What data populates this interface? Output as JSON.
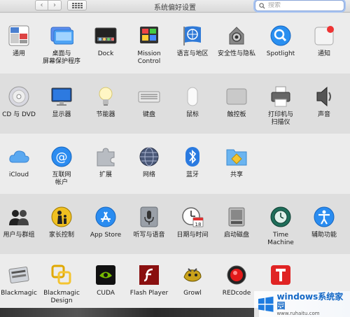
{
  "window": {
    "title": "系统偏好设置"
  },
  "toolbar": {
    "back_label": "‹",
    "forward_label": "›"
  },
  "search": {
    "placeholder": "搜索"
  },
  "rows": [
    {
      "items": [
        {
          "label": "通用",
          "icon": "general-icon"
        },
        {
          "label": "桌面与\n屏幕保护程序",
          "icon": "desktop-icon"
        },
        {
          "label": "Dock",
          "icon": "dock-icon"
        },
        {
          "label": "Mission\nControl",
          "icon": "mission-control-icon"
        },
        {
          "label": "语言与地区",
          "icon": "language-region-icon"
        },
        {
          "label": "安全性与隐私",
          "icon": "security-privacy-icon"
        },
        {
          "label": "Spotlight",
          "icon": "spotlight-icon"
        },
        {
          "label": "通知",
          "icon": "notifications-icon"
        }
      ]
    },
    {
      "items": [
        {
          "label": "CD 与 DVD",
          "icon": "cd-dvd-icon"
        },
        {
          "label": "显示器",
          "icon": "displays-icon"
        },
        {
          "label": "节能器",
          "icon": "energy-saver-icon"
        },
        {
          "label": "键盘",
          "icon": "keyboard-icon"
        },
        {
          "label": "鼠标",
          "icon": "mouse-icon"
        },
        {
          "label": "触控板",
          "icon": "trackpad-icon"
        },
        {
          "label": "打印机与\n扫描仪",
          "icon": "printer-icon"
        },
        {
          "label": "声音",
          "icon": "sound-icon"
        }
      ]
    },
    {
      "items": [
        {
          "label": "iCloud",
          "icon": "icloud-icon"
        },
        {
          "label": "互联网\n帐户",
          "icon": "internet-accounts-icon"
        },
        {
          "label": "扩展",
          "icon": "extensions-icon"
        },
        {
          "label": "网络",
          "icon": "network-icon"
        },
        {
          "label": "蓝牙",
          "icon": "bluetooth-icon"
        },
        {
          "label": "共享",
          "icon": "sharing-icon"
        }
      ]
    },
    {
      "items": [
        {
          "label": "用户与群组",
          "icon": "users-groups-icon"
        },
        {
          "label": "家长控制",
          "icon": "parental-controls-icon"
        },
        {
          "label": "App Store",
          "icon": "app-store-icon"
        },
        {
          "label": "听写与语音",
          "icon": "dictation-speech-icon"
        },
        {
          "label": "日期与时间",
          "icon": "date-time-icon"
        },
        {
          "label": "启动磁盘",
          "icon": "startup-disk-icon"
        },
        {
          "label": "Time Machine",
          "icon": "time-machine-icon"
        },
        {
          "label": "辅助功能",
          "icon": "accessibility-icon"
        }
      ]
    },
    {
      "items": [
        {
          "label": "Blackmagic",
          "icon": "blackmagic-icon"
        },
        {
          "label": "Blackmagic\nDesign",
          "icon": "blackmagic-design-icon"
        },
        {
          "label": "CUDA",
          "icon": "cuda-icon"
        },
        {
          "label": "Flash Player",
          "icon": "flash-player-icon"
        },
        {
          "label": "Growl",
          "icon": "growl-icon"
        },
        {
          "label": "REDcode",
          "icon": "redcode-icon"
        },
        {
          "label": "T",
          "icon": "tuxera-icon"
        }
      ]
    }
  ],
  "calendar_icon": {
    "day": "18"
  },
  "watermark": {
    "main": "windows系统家园",
    "sub": "",
    "url": "www.ruhaitu.com"
  },
  "colors": {
    "accent": "#1e7ce0",
    "search_ring": "#a8c4f2"
  }
}
